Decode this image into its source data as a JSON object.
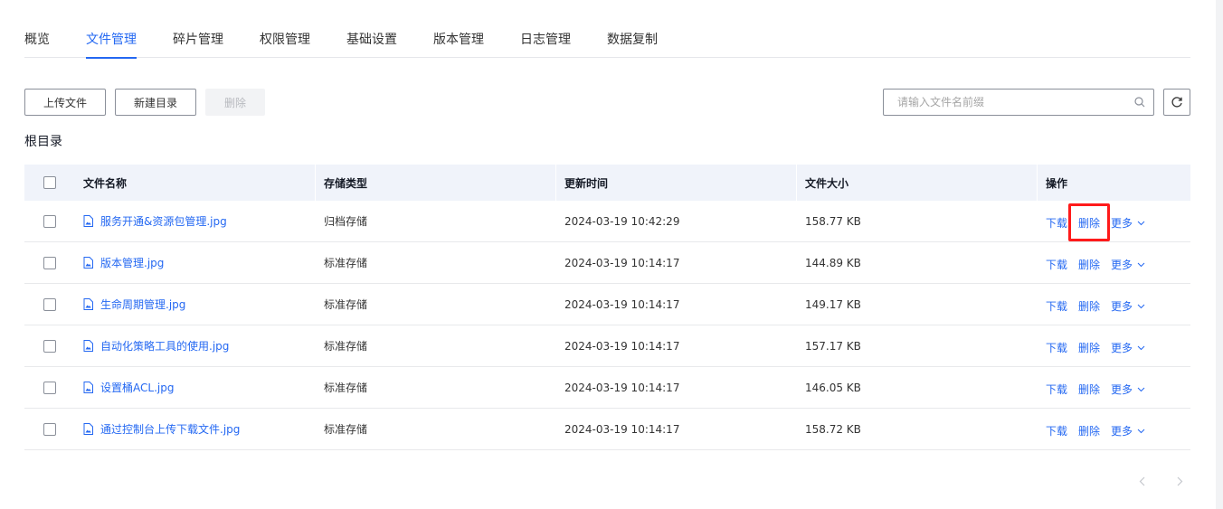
{
  "tabs": [
    "概览",
    "文件管理",
    "碎片管理",
    "权限管理",
    "基础设置",
    "版本管理",
    "日志管理",
    "数据复制"
  ],
  "active_tab": "文件管理",
  "toolbar": {
    "upload_label": "上传文件",
    "new_dir_label": "新建目录",
    "delete_label": "删除"
  },
  "search": {
    "placeholder": "请输入文件名前缀",
    "value": ""
  },
  "breadcrumb": "根目录",
  "table": {
    "headers": {
      "name": "文件名称",
      "type": "存储类型",
      "time": "更新时间",
      "size": "文件大小",
      "op": "操作"
    },
    "rows": [
      {
        "name": "服务开通&资源包管理.jpg",
        "type": "归档存储",
        "time": "2024-03-19 10:42:29",
        "size": "158.77 KB"
      },
      {
        "name": "版本管理.jpg",
        "type": "标准存储",
        "time": "2024-03-19 10:14:17",
        "size": "144.89 KB"
      },
      {
        "name": "生命周期管理.jpg",
        "type": "标准存储",
        "time": "2024-03-19 10:14:17",
        "size": "149.17 KB"
      },
      {
        "name": "自动化策略工具的使用.jpg",
        "type": "标准存储",
        "time": "2024-03-19 10:14:17",
        "size": "157.17 KB"
      },
      {
        "name": "设置桶ACL.jpg",
        "type": "标准存储",
        "time": "2024-03-19 10:14:17",
        "size": "146.05 KB"
      },
      {
        "name": "通过控制台上传下载文件.jpg",
        "type": "标准存储",
        "time": "2024-03-19 10:14:17",
        "size": "158.72 KB"
      }
    ],
    "actions": {
      "download": "下载",
      "delete": "删除",
      "more": "更多"
    }
  },
  "colors": {
    "accent": "#2468f2",
    "highlight": "#ff1a1a",
    "header_bg": "#f0f3fa"
  }
}
